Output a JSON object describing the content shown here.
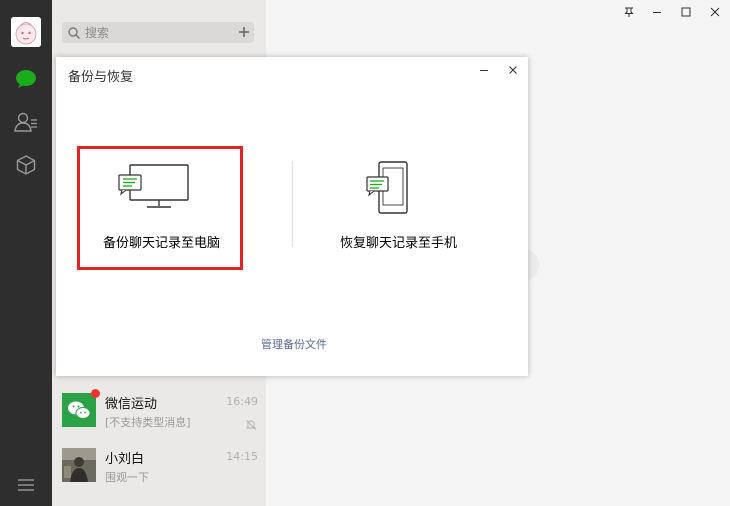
{
  "search": {
    "placeholder": "搜索"
  },
  "chat_list": [
    {
      "name": "微信运动",
      "message": "[不支持类型消息]",
      "time": "16:49",
      "has_badge": true,
      "muted": true
    },
    {
      "name": "小刘白",
      "message": "围观一下",
      "time": "14:15",
      "has_badge": false,
      "muted": false
    }
  ],
  "dialog": {
    "title": "备份与恢复",
    "backup_label": "备份聊天记录至电脑",
    "restore_label": "恢复聊天记录至手机",
    "manage_link": "管理备份文件"
  },
  "colors": {
    "sidebar": "#2e2e2e",
    "accent_green": "#1aad19",
    "highlight_red": "#e02424",
    "link_blue": "#576b95"
  },
  "icons": {
    "sidebar": [
      "chat-icon",
      "contacts-icon",
      "favorites-cube-icon",
      "menu-icon"
    ],
    "window": [
      "pin-icon",
      "minimize-icon",
      "maximize-icon",
      "close-icon"
    ]
  }
}
